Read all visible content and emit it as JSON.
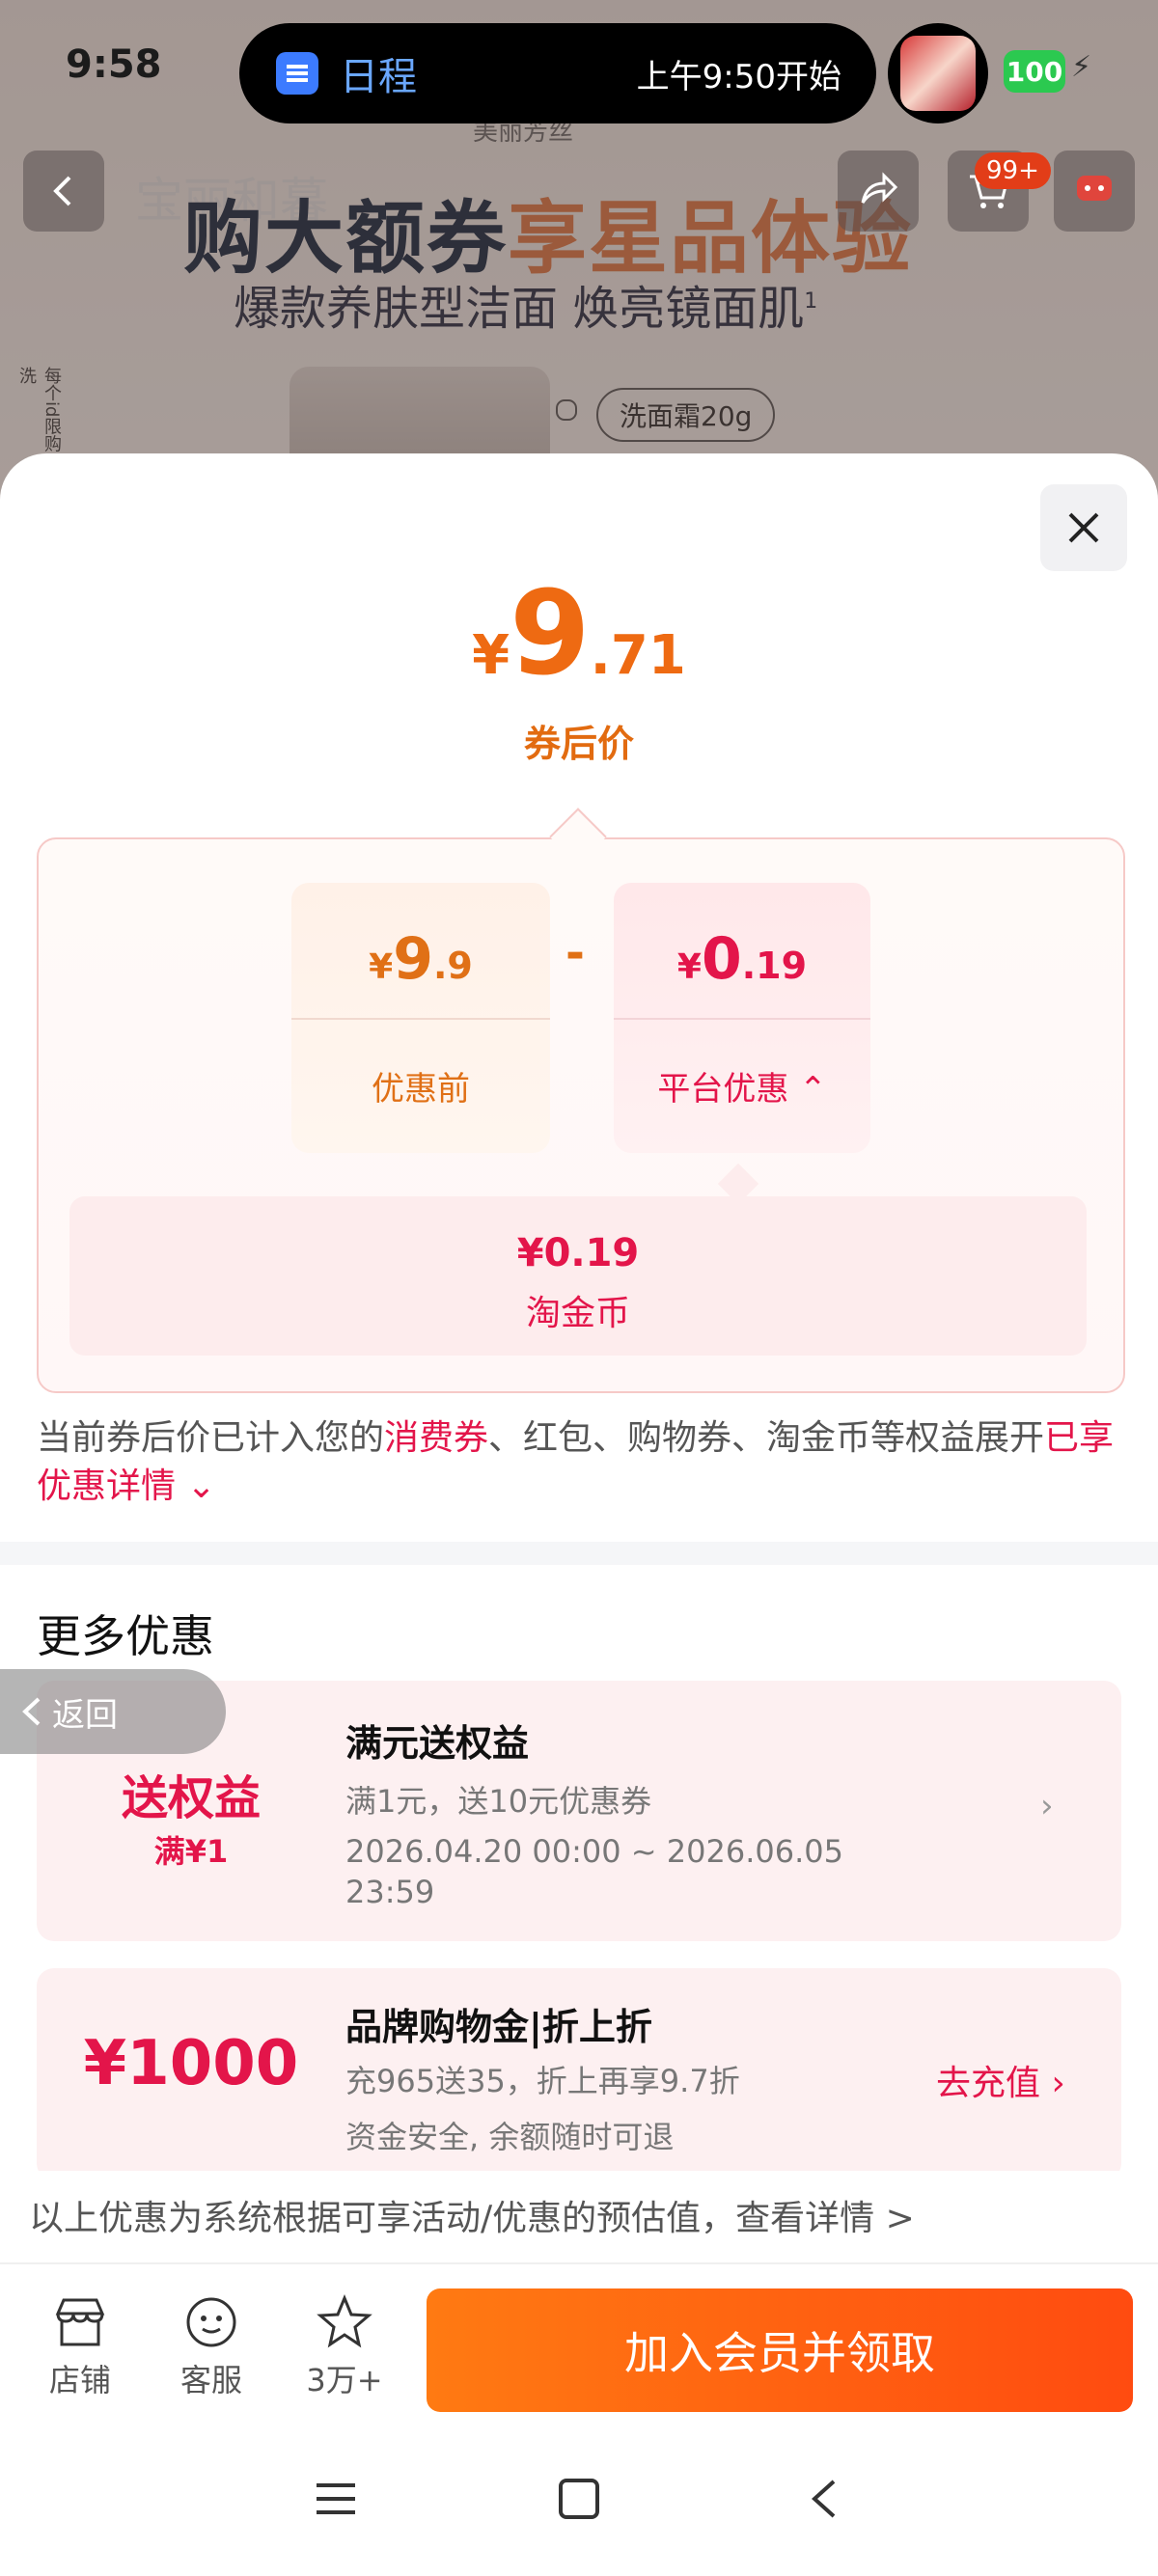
{
  "status_bar": {
    "time": "9:58",
    "battery": "100"
  },
  "island": {
    "app": "日程",
    "event": "上午9:50开始"
  },
  "bg": {
    "shop_name": "宝丽和暮",
    "brand_caption": "美丽芳丝",
    "cart_badge": "99+",
    "headline_a": "购大额券",
    "headline_b": "享星品体验",
    "subline": "爆款养肤型洁面 焕亮镜面肌",
    "subline_sup": "1",
    "product_tag": "洗面霜20g",
    "side_note": "每个id限购·赠品洗"
  },
  "price": {
    "symbol": "¥",
    "int": "9",
    "dec": ".71",
    "label": "券后价"
  },
  "breakdown": {
    "original": {
      "symbol": "¥",
      "int": "9",
      "dec": ".9",
      "label": "优惠前"
    },
    "operator": "-",
    "discount": {
      "symbol": "¥",
      "int": "0",
      "dec": ".19",
      "label": "平台优惠",
      "toggle": "⌃"
    },
    "coin": {
      "amount": "¥0.19",
      "label": "淘金币"
    }
  },
  "note": {
    "pre": "当前券后价已计入您的",
    "link1": "消费券",
    "mid": "、红包、购物券、淘金币等权益展开",
    "link2": "已享优惠详情",
    "caret": "⌄"
  },
  "more": {
    "title": "更多优惠",
    "back": "返回",
    "promos": [
      {
        "left_main": "送权益",
        "left_sub": "满¥1",
        "title": "满元送权益",
        "sub1": "满1元，送10元优惠券",
        "sub2": "2026.04.20 00:00 ~ 2026.06.05 23:59"
      },
      {
        "left_main": "¥1000",
        "title": "品牌购物金|折上折",
        "sub1": "充965送35，折上再享9.7折",
        "sub2": "资金安全, 余额随时可退",
        "action": "去充值"
      }
    ],
    "disclaimer": "以上优惠为系统根据可享活动/优惠的预估值，查看详情 >"
  },
  "bottom": {
    "store": "店铺",
    "service": "客服",
    "fav": "3万+",
    "cta": "加入会员并领取"
  },
  "colors": {
    "accent_orange": "#ee6a12",
    "accent_red": "#e3154a",
    "cta_start": "#ff7a12",
    "cta_end": "#ff4b10"
  }
}
